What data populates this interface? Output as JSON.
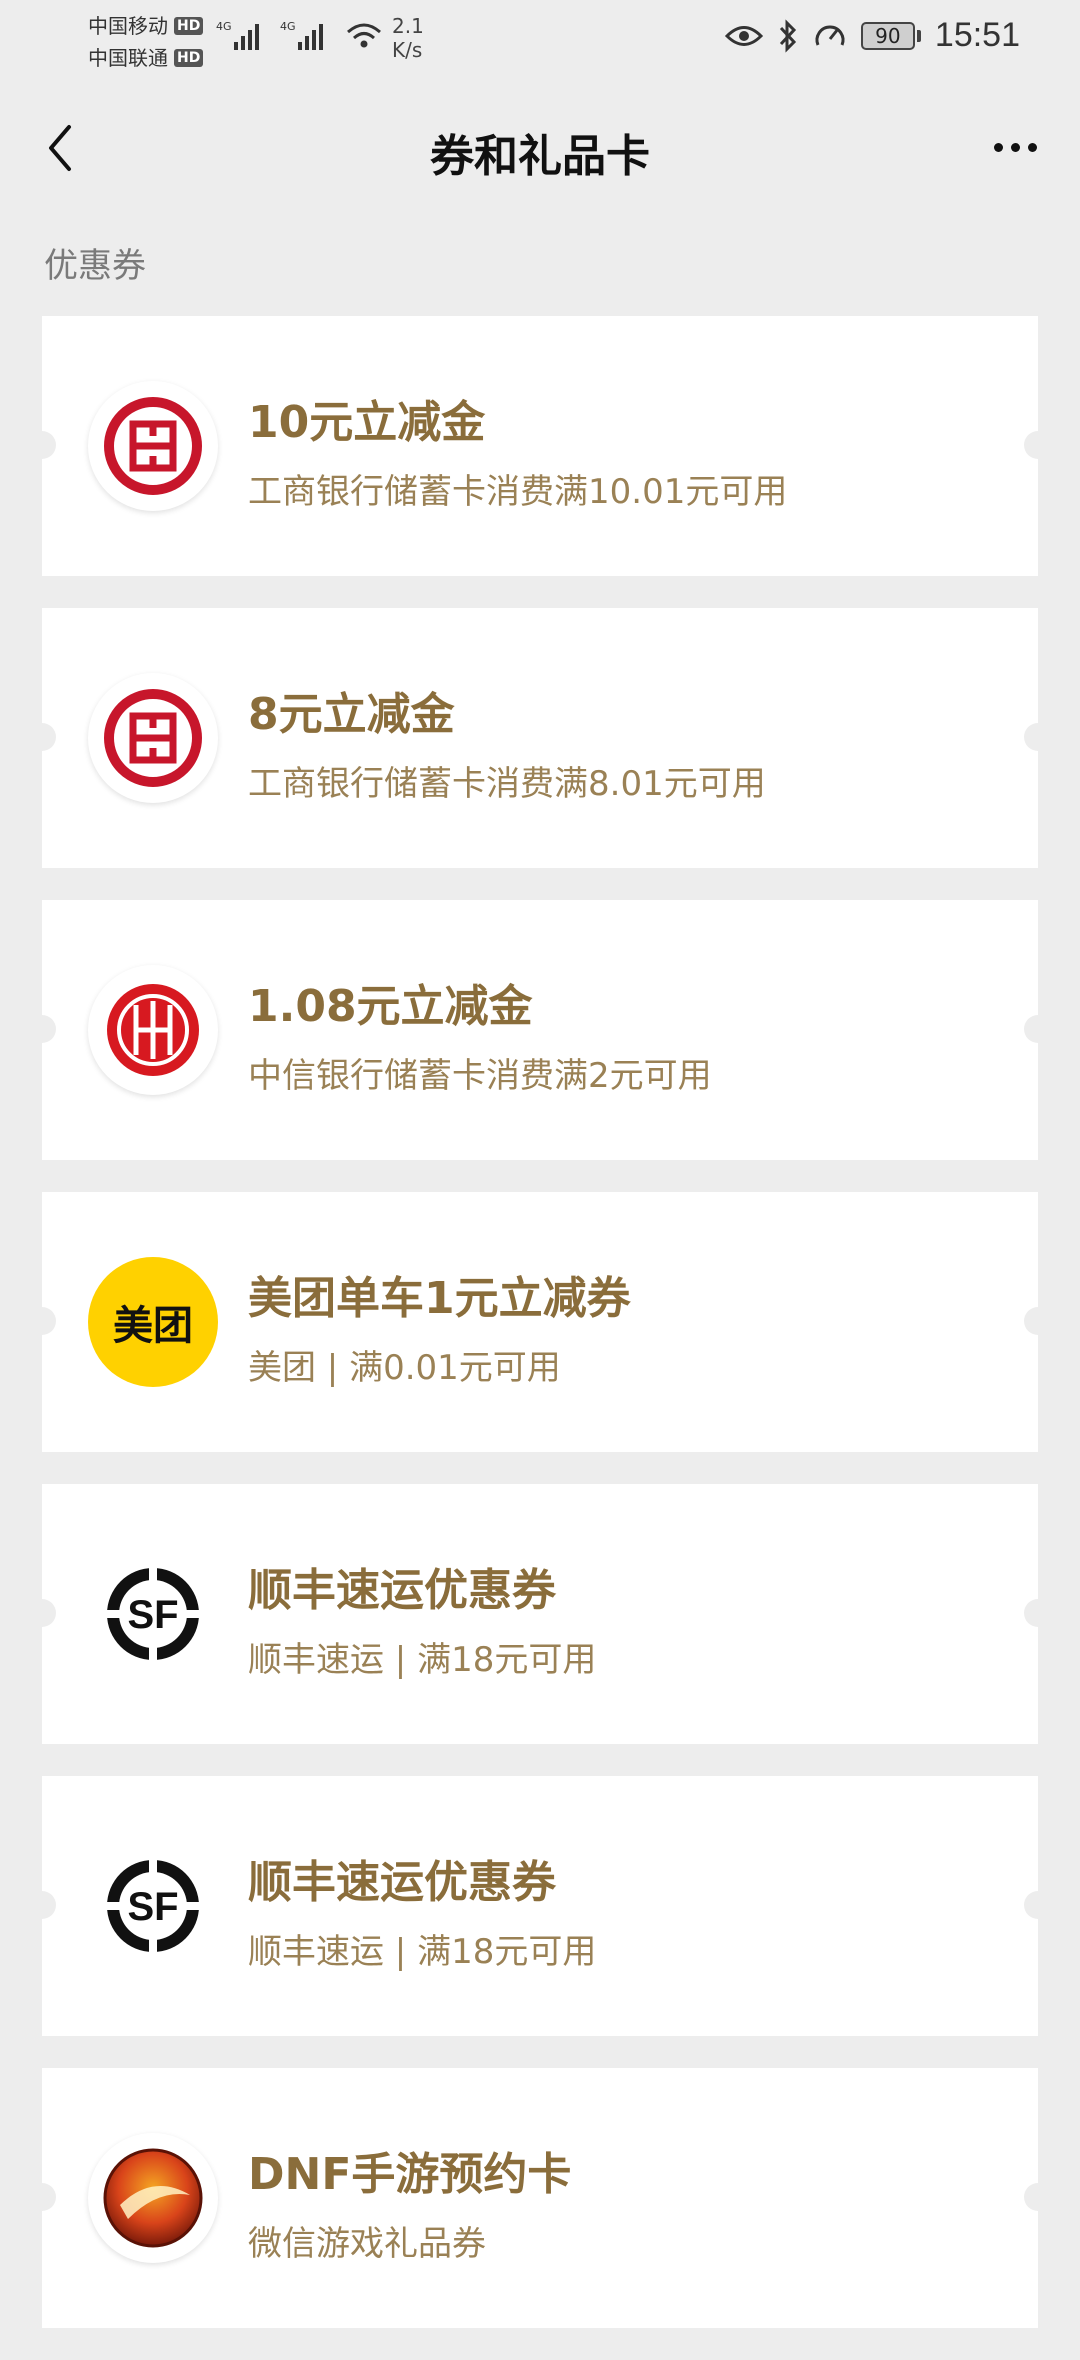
{
  "status": {
    "carrier1": "中国移动",
    "carrier2": "中国联通",
    "hd": "HD",
    "net_type": "4G",
    "speed_value": "2.1",
    "speed_unit": "K/s",
    "battery": "90",
    "time": "15:51"
  },
  "nav": {
    "title": "券和礼品卡"
  },
  "section": {
    "label": "优惠券"
  },
  "coupons": [
    {
      "title": "10元立减金",
      "desc": "工商银行储蓄卡消费满10.01元可用",
      "logo": "icbc-logo"
    },
    {
      "title": "8元立减金",
      "desc": "工商银行储蓄卡消费满8.01元可用",
      "logo": "icbc-logo"
    },
    {
      "title": "1.08元立减金",
      "desc": "中信银行储蓄卡消费满2元可用",
      "logo": "citic-logo"
    },
    {
      "title": "美团单车1元立减券",
      "desc": "美团 | 满0.01元可用",
      "logo": "meituan-logo",
      "logo_text": "美团"
    },
    {
      "title": "顺丰速运优惠券",
      "desc": "顺丰速运 | 满18元可用",
      "logo": "sf-logo",
      "logo_text": "SF"
    },
    {
      "title": "顺丰速运优惠券",
      "desc": "顺丰速运 | 满18元可用",
      "logo": "sf-logo",
      "logo_text": "SF"
    },
    {
      "title": "DNF手游预约卡",
      "desc": "微信游戏礼品券",
      "logo": "dnf-logo"
    }
  ],
  "colors": {
    "title": "#8a6d3b",
    "desc": "#9a8155",
    "icbc": "#c7162b",
    "meituan": "#ffd100"
  }
}
